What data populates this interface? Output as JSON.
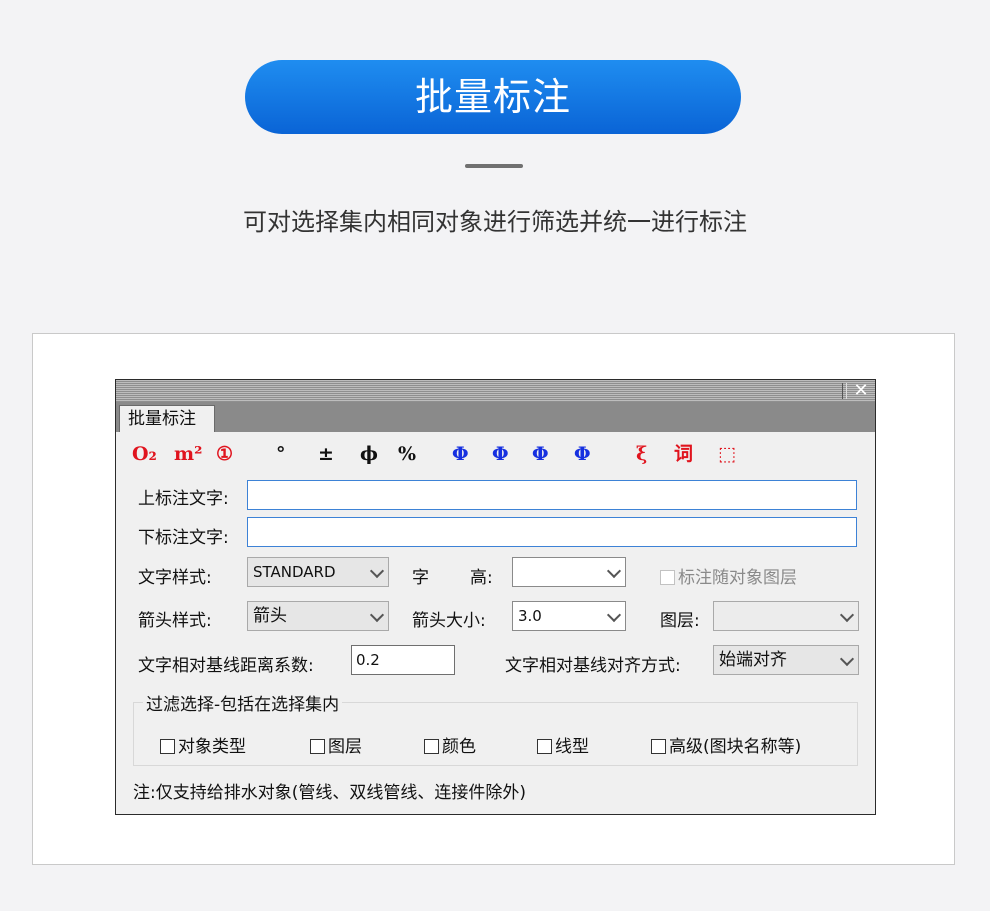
{
  "hero": {
    "title": "批量标注",
    "subtitle": "可对选择集内相同对象进行筛选并统一进行标注"
  },
  "dialog": {
    "tab_label": "批量标注",
    "close_icon": "✕",
    "symbols": [
      "O₂",
      "m²",
      "①",
      "°",
      "±",
      "ϕ",
      "%",
      "Φ",
      "Φ",
      "Φ",
      "Φ",
      "ξ",
      "词",
      "⬚"
    ],
    "upper_text_label": "上标注文字:",
    "upper_text_value": "",
    "lower_text_label": "下标注文字:",
    "lower_text_value": "",
    "text_style_label": "文字样式:",
    "text_style_value": "STANDARD",
    "char_label": "字",
    "height_label": "高:",
    "height_value": "",
    "follow_layer_label": "标注随对象图层",
    "arrow_style_label": "箭头样式:",
    "arrow_style_value": "箭头",
    "arrow_size_label": "箭头大小:",
    "arrow_size_value": "3.0",
    "layer_label": "图层:",
    "layer_value": "",
    "distance_label": "文字相对基线距离系数:",
    "distance_value": "0.2",
    "align_label": "文字相对基线对齐方式:",
    "align_value": "始端对齐",
    "filter_group_title": "过滤选择-包括在选择集内",
    "filters": [
      "对象类型",
      "图层",
      "颜色",
      "线型",
      "高级(图块名称等)"
    ],
    "note": "注:仅支持给排水对象(管线、双线管线、连接件除外)"
  },
  "colors": {
    "accent": "#0a64d6",
    "symbol_red": "#e0141e",
    "symbol_blue": "#1630e0"
  }
}
